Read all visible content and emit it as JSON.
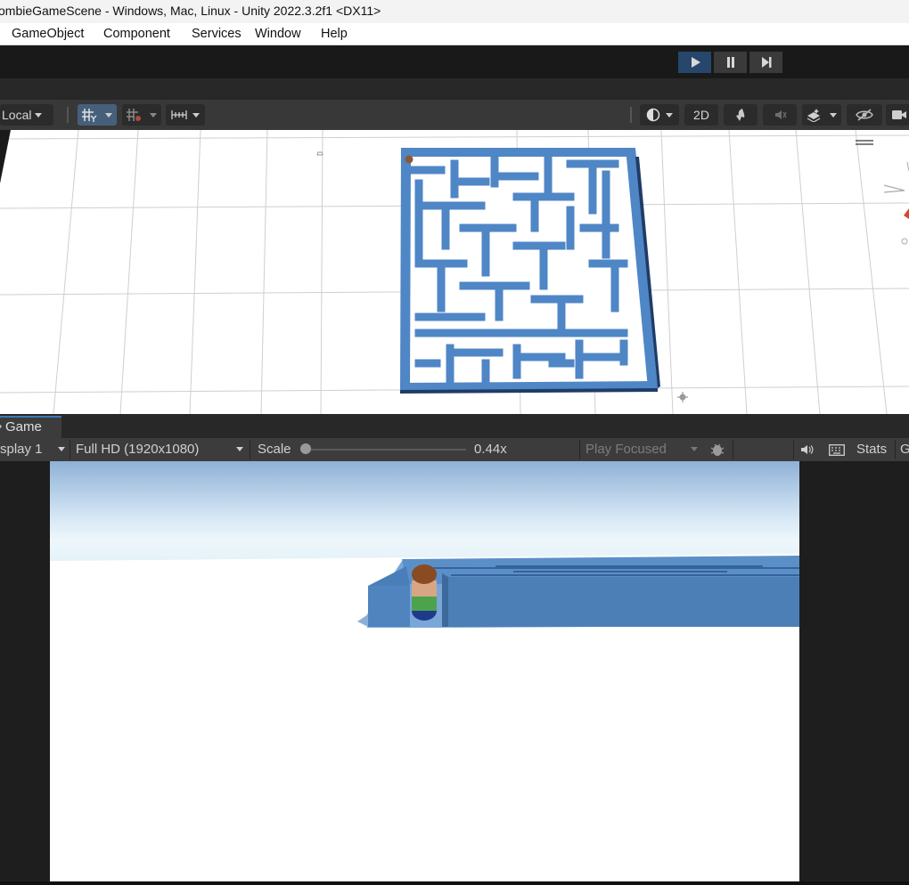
{
  "window": {
    "title": "ombieGameScene - Windows, Mac, Linux - Unity 2022.3.2f1 <DX11>"
  },
  "menu": {
    "items": [
      "GameObject",
      "Component",
      "Services",
      "Window",
      "Help"
    ]
  },
  "playbar": {
    "play_icon": "play-icon",
    "pause_icon": "pause-icon",
    "step_icon": "step-icon"
  },
  "scene_toolbar": {
    "pivot_label": "Local",
    "view_mode_label": "2D",
    "icons": [
      "grid-snap-icon",
      "increment-snap-icon",
      "ruler-icon",
      "shading-mode-icon",
      "lighting-icon",
      "audio-icon",
      "effects-icon",
      "visibility-icon",
      "camera-icon"
    ]
  },
  "game_tabs": {
    "game_label": "Game"
  },
  "game_toolbar": {
    "display": "splay 1",
    "resolution": "Full HD (1920x1080)",
    "scale_label": "Scale",
    "scale_value": "0.44x",
    "play_mode": "Play Focused",
    "stats_label": "Stats",
    "gizmos_label": "G"
  },
  "colors": {
    "accent": "#3a79bb",
    "play_active": "#26466b",
    "maze": "#4f86c6"
  }
}
